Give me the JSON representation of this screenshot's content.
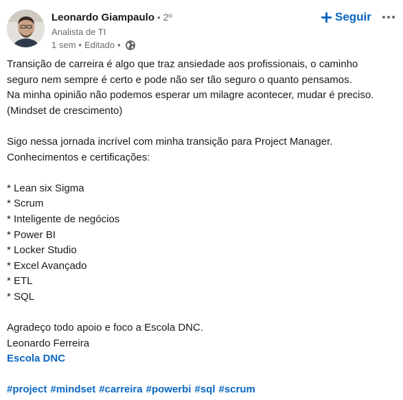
{
  "author": {
    "name": "Leonardo Giampaulo",
    "separator": "•",
    "degree": "2º",
    "headline": "Analista de TI",
    "time": "1 sem",
    "dot": "•",
    "edited": "Editado",
    "dot2": "•",
    "visibility_icon": "globe-icon"
  },
  "actions": {
    "follow_label": "Seguir",
    "follow_icon": "plus-icon",
    "more_icon": "more-icon"
  },
  "post": {
    "lines": [
      "Transição de carreira é algo que traz ansiedade aos profissionais, o caminho",
      "seguro nem sempre é certo e pode não ser tão seguro o quanto pensamos.",
      "Na minha opinião não podemos esperar um milagre acontecer, mudar é preciso.",
      "(Mindset de crescimento)",
      "",
      "Sigo nessa jornada incrível com minha transição para Project Manager.",
      "Conhecimentos e certificações:",
      "",
      "* Lean six Sigma",
      "* Scrum",
      "* Inteligente de negócios",
      "* Power BI",
      "* Locker Studio",
      "* Excel Avançado",
      "* ETL",
      "* SQL",
      "",
      "Agradeço todo apoio e foco a Escola DNC.",
      "Leonardo Ferreira"
    ],
    "mention": "Escola DNC",
    "hashtags": [
      "#project",
      "#mindset",
      "#carreira",
      "#powerbi",
      "#sql",
      "#scrum"
    ]
  },
  "colors": {
    "link": "#0a66c2",
    "text": "#191919",
    "muted": "#666666"
  }
}
